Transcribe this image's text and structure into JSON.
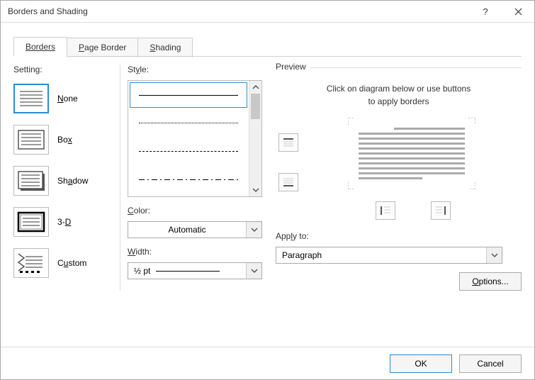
{
  "window": {
    "title": "Borders and Shading"
  },
  "tabs": [
    "Borders",
    "Page Border",
    "Shading"
  ],
  "active_tab": 0,
  "setting": {
    "label": "Setting:",
    "items": [
      {
        "key": "none",
        "label_pre": "",
        "accel": "N",
        "label_post": "one"
      },
      {
        "key": "box",
        "label_pre": "Bo",
        "accel": "x",
        "label_post": ""
      },
      {
        "key": "shadow",
        "label_pre": "Sh",
        "accel": "a",
        "label_post": "dow"
      },
      {
        "key": "3d",
        "label_pre": "3-",
        "accel": "D",
        "label_post": ""
      },
      {
        "key": "custom",
        "label_pre": "C",
        "accel": "u",
        "label_post": "stom"
      }
    ],
    "selected": 0
  },
  "style": {
    "label": "Style:"
  },
  "color": {
    "label": "Color:",
    "value": "Automatic"
  },
  "width": {
    "label": "Width:",
    "value": "½ pt"
  },
  "preview": {
    "label": "Preview",
    "hint1": "Click on diagram below or use buttons",
    "hint2": "to apply borders"
  },
  "apply_to": {
    "label": "Apply to:",
    "value": "Paragraph"
  },
  "buttons": {
    "options": "Options...",
    "ok": "OK",
    "cancel": "Cancel"
  }
}
